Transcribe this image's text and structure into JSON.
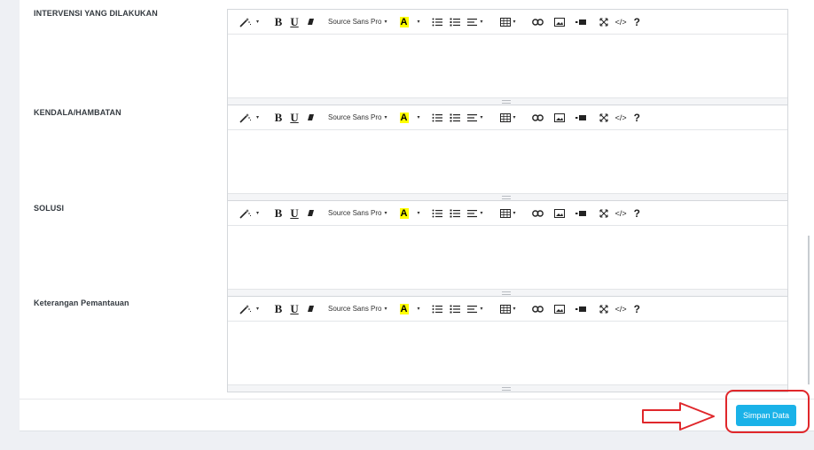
{
  "form": {
    "fields": [
      {
        "label": "INTERVENSI YANG DILAKUKAN"
      },
      {
        "label": "KENDALA/HAMBATAN"
      },
      {
        "label": "SOLUSI"
      },
      {
        "label": "Keterangan Pemantauan"
      }
    ]
  },
  "toolbar": {
    "bold": "B",
    "underline": "U",
    "font_name": "Source Sans Pro",
    "font_caret": "▾",
    "color_letter": "A",
    "code": "</>",
    "help": "?"
  },
  "actions": {
    "save_label": "Simpan Data"
  },
  "colors": {
    "primary": "#1ab2e8",
    "annotation": "#e0272b",
    "highlight": "#ffff00"
  },
  "icons": [
    "magic-wand-icon",
    "eraser-icon",
    "unordered-list-icon",
    "ordered-list-icon",
    "align-icon",
    "table-icon",
    "link-icon",
    "picture-icon",
    "video-icon",
    "fullscreen-icon",
    "code-view-icon",
    "help-icon"
  ]
}
